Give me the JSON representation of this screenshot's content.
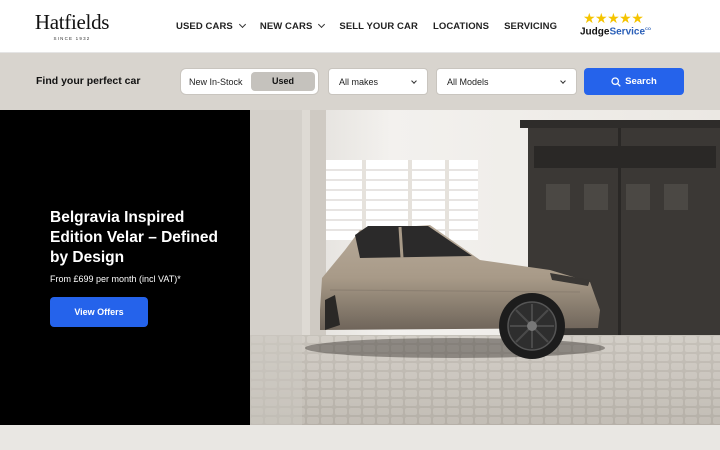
{
  "brand": {
    "name": "Hatfields",
    "since": "SINCE 1932"
  },
  "nav": [
    {
      "label": "USED CARS",
      "dropdown": true
    },
    {
      "label": "NEW CARS",
      "dropdown": true
    },
    {
      "label": "SELL YOUR CAR",
      "dropdown": false
    },
    {
      "label": "LOCATIONS",
      "dropdown": false
    },
    {
      "label": "SERVICING",
      "dropdown": false
    }
  ],
  "rating": {
    "stars": "★★★★★",
    "judge": "Judge",
    "service": "Service",
    "suffix": "CO"
  },
  "search": {
    "heading": "Find your perfect car",
    "toggle_new": "New In-Stock",
    "toggle_used": "Used",
    "makes": "All makes",
    "models": "All Models",
    "button": "Search"
  },
  "hero": {
    "title": "Belgravia Inspired Edition Velar – Defined by Design",
    "subtitle": "From £699 per month (incl VAT)*",
    "cta": "View Offers"
  },
  "colors": {
    "accent": "#2563eb",
    "bar": "#d8d4ce",
    "star": "#f5c400"
  }
}
